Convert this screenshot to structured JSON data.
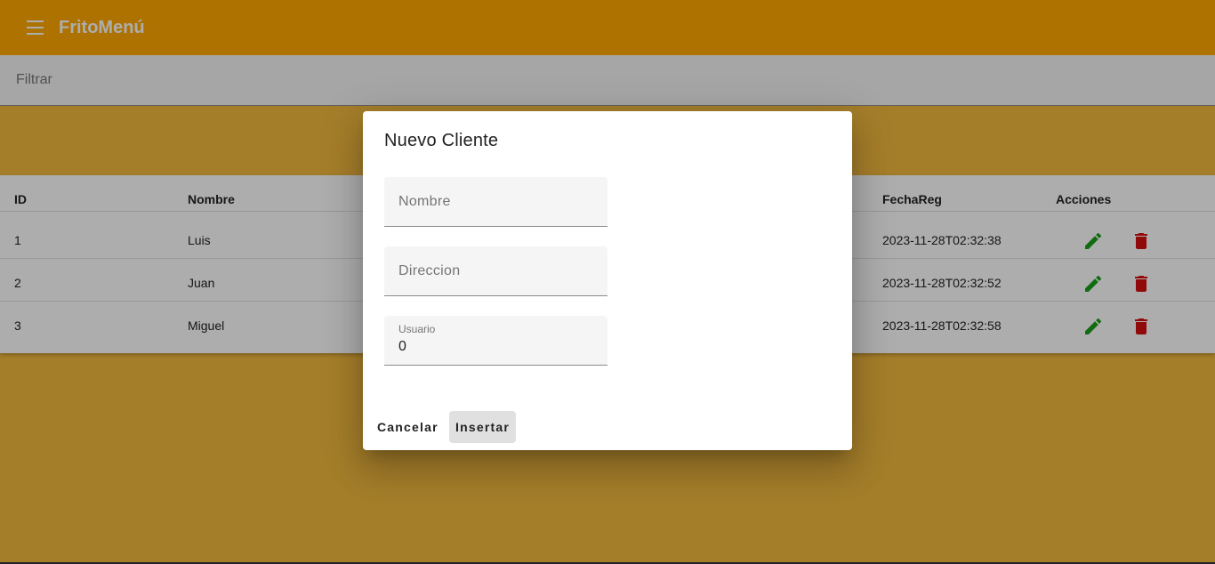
{
  "colors": {
    "toolbar_bg": "#ffa800",
    "page_bg": "#f4ba3f",
    "edit_icon": "#1aa01a",
    "delete_icon": "#d61010"
  },
  "toolbar": {
    "menu_icon": "menu-icon",
    "title": "FritoMenú"
  },
  "filter": {
    "placeholder": "Filtrar"
  },
  "table": {
    "headers": {
      "id": "ID",
      "nombre": "Nombre",
      "fechareg": "FechaReg",
      "acciones": "Acciones"
    },
    "rows": [
      {
        "id": "1",
        "nombre": "Luis",
        "fechareg": "2023-11-28T02:32:38"
      },
      {
        "id": "2",
        "nombre": "Juan",
        "fechareg": "2023-11-28T02:32:52"
      },
      {
        "id": "3",
        "nombre": "Miguel",
        "fechareg": "2023-11-28T02:32:58"
      }
    ],
    "action_icons": [
      "edit-icon",
      "delete-icon"
    ]
  },
  "dialog": {
    "title": "Nuevo Cliente",
    "fields": {
      "nombre_placeholder": "Nombre",
      "direccion_placeholder": "Direccion",
      "usuario_label": "Usuario",
      "usuario_value": "0"
    },
    "buttons": {
      "cancel": "Cancelar",
      "insert": "Insertar"
    }
  }
}
